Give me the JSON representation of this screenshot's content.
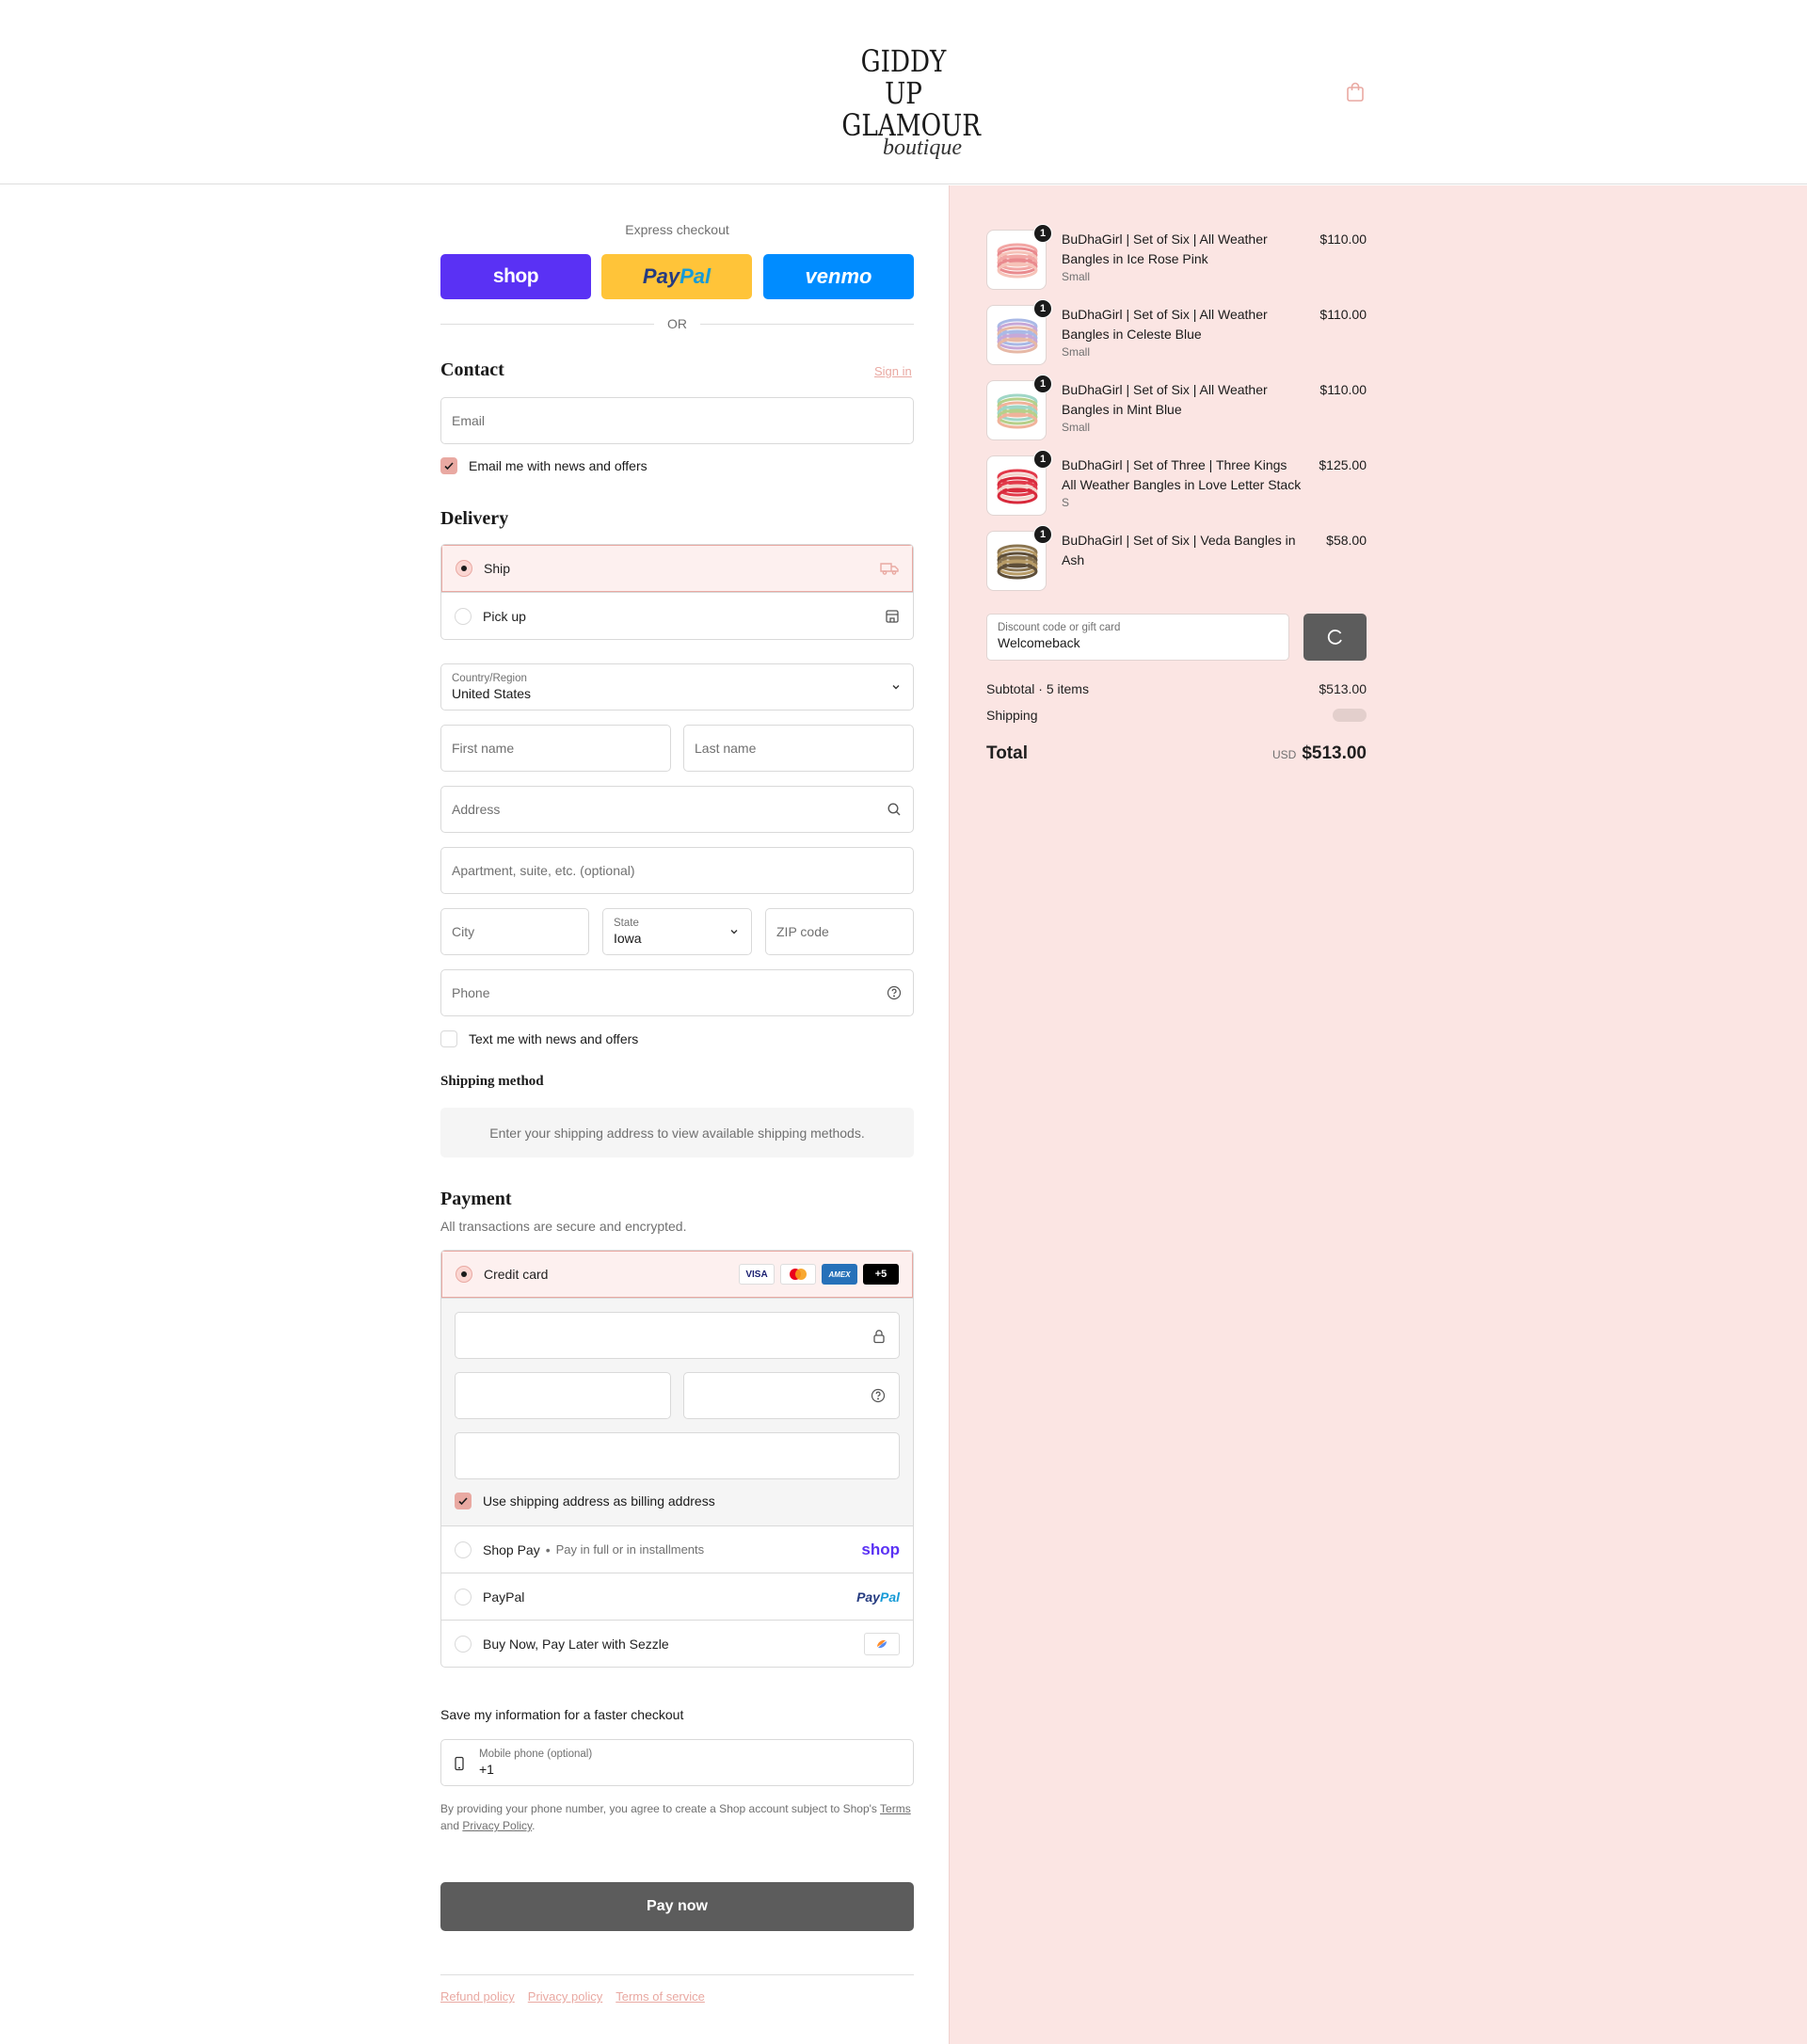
{
  "brand": {
    "line1": "GIDDY UP",
    "line2": "GLAMOUR",
    "line3": "boutique"
  },
  "express": {
    "label": "Express checkout",
    "shop": "shop",
    "paypal_a": "Pay",
    "paypal_b": "Pal",
    "venmo": "venmo",
    "or": "OR"
  },
  "contact": {
    "title": "Contact",
    "sign_in": "Sign in",
    "email_placeholder": "Email",
    "news_label": "Email me with news and offers"
  },
  "delivery": {
    "title": "Delivery",
    "options": [
      {
        "label": "Ship"
      },
      {
        "label": "Pick up"
      }
    ],
    "country_label": "Country/Region",
    "country_value": "United States",
    "first_name": "First name",
    "last_name": "Last name",
    "address": "Address",
    "apartment": "Apartment, suite, etc. (optional)",
    "city": "City",
    "state_label": "State",
    "state_value": "Iowa",
    "zip": "ZIP code",
    "phone": "Phone",
    "text_label": "Text me with news and offers"
  },
  "shipping_method": {
    "title": "Shipping method",
    "info": "Enter your shipping address to view available shipping methods."
  },
  "payment": {
    "title": "Payment",
    "subtitle": "All transactions are secure and encrypted.",
    "credit_card": "Credit card",
    "cards": [
      "VISA",
      "AMEX",
      "+5"
    ],
    "billing_label": "Use shipping address as billing address",
    "shop_pay": "Shop Pay",
    "shop_pay_sub": "Pay in full or in installments",
    "shop_logo": "shop",
    "paypal": "PayPal",
    "paypal_logo_a": "Pay",
    "paypal_logo_b": "Pal",
    "sezzle": "Buy Now, Pay Later with Sezzle"
  },
  "save_info": {
    "title": "Save my information for a faster checkout",
    "mobile_label": "Mobile phone (optional)",
    "mobile_value": "+1",
    "legal_a": "By providing your phone number, you agree to create a Shop account subject to Shop's",
    "terms": "Terms",
    "legal_and": "and",
    "privacy": "Privacy Policy",
    "legal_end": "."
  },
  "pay_now": "Pay now",
  "footer": [
    "Refund policy",
    "Privacy policy",
    "Terms of service"
  ],
  "cart": {
    "items": [
      {
        "name": "BuDhaGirl | Set of Six | All Weather Bangles in Ice Rose Pink",
        "variant": "Small",
        "price": "$110.00",
        "qty": "1",
        "colors": [
          "#f2a6a4",
          "#e98a8e",
          "#f6c2b8"
        ]
      },
      {
        "name": "BuDhaGirl | Set of Six | All Weather Bangles in Celeste Blue",
        "variant": "Small",
        "price": "$110.00",
        "qty": "1",
        "colors": [
          "#a9b9e6",
          "#c7a8d8",
          "#e6b8a6"
        ]
      },
      {
        "name": "BuDhaGirl | Set of Six | All Weather Bangles in Mint Blue",
        "variant": "Small",
        "price": "$110.00",
        "qty": "1",
        "colors": [
          "#9fd6c6",
          "#b6d08a",
          "#f0b39a"
        ]
      },
      {
        "name": "BuDhaGirl | Set of Three | Three Kings All Weather Bangles in Love Letter Stack",
        "variant": "S",
        "price": "$125.00",
        "qty": "1",
        "colors": [
          "#e23a4a",
          "#f4d4cc",
          "#d82a3c"
        ]
      },
      {
        "name": "BuDhaGirl | Set of Six | Veda Bangles in Ash",
        "variant": "",
        "price": "$58.00",
        "qty": "1",
        "colors": [
          "#8a7450",
          "#b79b66",
          "#5e4e38"
        ]
      }
    ],
    "discount_label": "Discount code or gift card",
    "discount_value": "Welcomeback",
    "subtotal_label": "Subtotal · 5 items",
    "subtotal_value": "$513.00",
    "shipping_label": "Shipping",
    "total_label": "Total",
    "currency": "USD",
    "total_value": "$513.00"
  },
  "colors": {
    "accent": "#e9a9a2",
    "panel": "#fbe5e3",
    "button": "#5c5c5c"
  }
}
